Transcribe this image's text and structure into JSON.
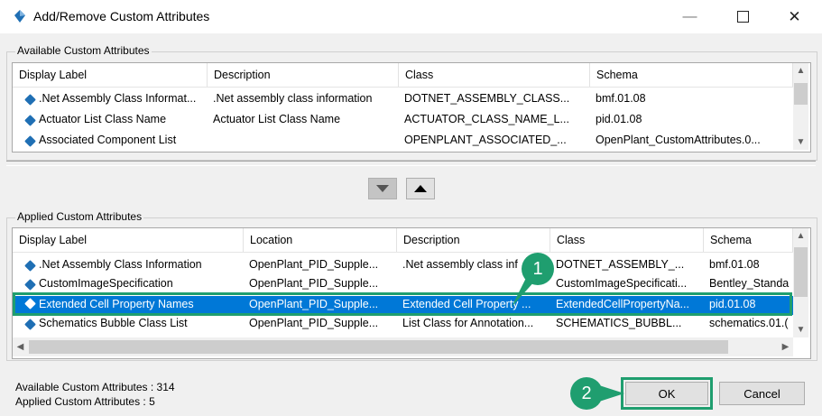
{
  "window": {
    "title": "Add/Remove Custom Attributes"
  },
  "available": {
    "group_label": "Available Custom Attributes",
    "columns": [
      "Display Label",
      "Description",
      "Class",
      "Schema"
    ],
    "rows": [
      [
        ".Net Assembly Class Informat...",
        ".Net assembly class information",
        "DOTNET_ASSEMBLY_CLASS...",
        "bmf.01.08"
      ],
      [
        "Actuator List Class Name",
        "Actuator List Class Name",
        "ACTUATOR_CLASS_NAME_L...",
        "pid.01.08"
      ],
      [
        "Associated Component List",
        "",
        "OPENPLANT_ASSOCIATED_...",
        "OpenPlant_CustomAttributes.0..."
      ]
    ]
  },
  "move_buttons": {
    "down_icon": "arrow-down-icon",
    "up_icon": "arrow-up-icon"
  },
  "applied": {
    "group_label": "Applied Custom Attributes",
    "columns": [
      "Display Label",
      "Location",
      "Description",
      "Class",
      "Schema"
    ],
    "rows": [
      [
        ".Net Assembly Class Information",
        "OpenPlant_PID_Supple...",
        ".Net assembly class inf",
        "DOTNET_ASSEMBLY_...",
        "bmf.01.08"
      ],
      [
        "CustomImageSpecification",
        "OpenPlant_PID_Supple...",
        "",
        "CustomImageSpecificati...",
        "Bentley_Standa"
      ],
      [
        "Extended Cell Property Names",
        "OpenPlant_PID_Supple...",
        "Extended Cell Property ...",
        "ExtendedCellPropertyNa...",
        "pid.01.08"
      ],
      [
        "Schematics Bubble Class List",
        "OpenPlant_PID_Supple...",
        "List Class for Annotation...",
        "SCHEMATICS_BUBBL...",
        "schematics.01.("
      ]
    ],
    "selected_row": 2
  },
  "status": {
    "available_count": "Available Custom Attributes : 314",
    "applied_count": "Applied Custom Attributes : 5"
  },
  "buttons": {
    "ok": "OK",
    "cancel": "Cancel"
  },
  "callouts": {
    "one": "1",
    "two": "2"
  },
  "colors": {
    "selection": "#0078d7",
    "callout": "#1f9e6f",
    "icon": "#1f6fb4"
  }
}
